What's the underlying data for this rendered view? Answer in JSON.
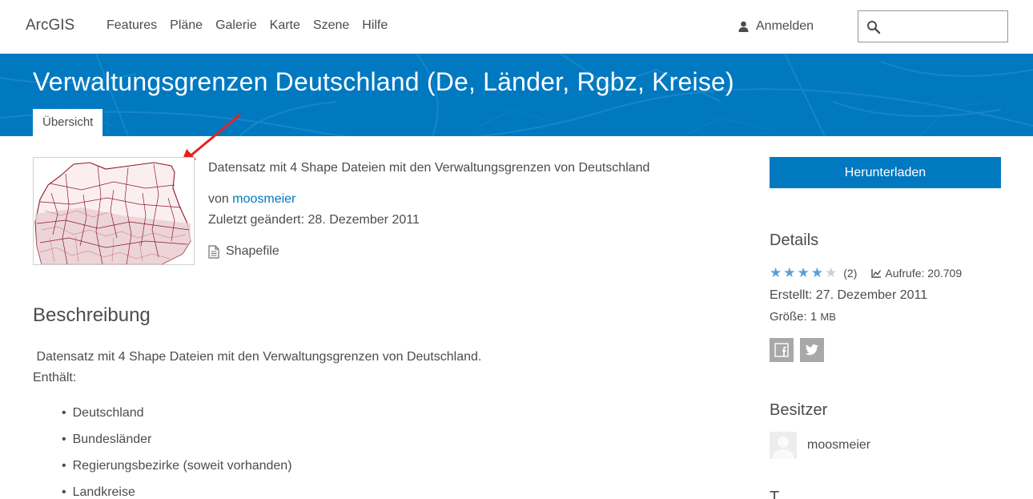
{
  "nav": {
    "brand": "ArcGIS",
    "links": [
      "Features",
      "Pläne",
      "Galerie",
      "Karte",
      "Szene",
      "Hilfe"
    ],
    "signin": "Anmelden",
    "search_placeholder": ""
  },
  "banner": {
    "title": "Verwaltungsgrenzen Deutschland (De, Länder, Rgbz, Kreise)",
    "tab": "Übersicht"
  },
  "item": {
    "summary": "Datensatz mit 4 Shape Dateien mit den Verwaltungsgrenzen von Deutschland",
    "by_prefix": "von",
    "owner": "moosmeier",
    "modified": "Zuletzt geändert: 28. Dezember 2011",
    "type": "Shapefile"
  },
  "description": {
    "heading": "Beschreibung",
    "p1": "Datensatz mit 4 Shape Dateien mit den Verwaltungsgrenzen von Deutschland.",
    "p2": "Enthält:",
    "items": [
      "Deutschland",
      "Bundesländer",
      "Regierungsbezirke (soweit vorhanden)",
      "Landkreise"
    ]
  },
  "sidebar": {
    "download": "Herunterladen",
    "details_heading": "Details",
    "rating_stars": 4,
    "rating_max": 5,
    "rating_count": "(2)",
    "views": "Aufrufe: 20.709",
    "created": "Erstellt: 27. Dezember 2011",
    "size_label": "Größe: 1",
    "size_unit": "MB",
    "owner_heading": "Besitzer",
    "owner_name": "moosmeier",
    "tags_heading": "T"
  },
  "colors": {
    "accent": "#0079c1",
    "text": "#4c4c4c",
    "star": "#5a9fd4",
    "arrow": "#e8201f"
  }
}
